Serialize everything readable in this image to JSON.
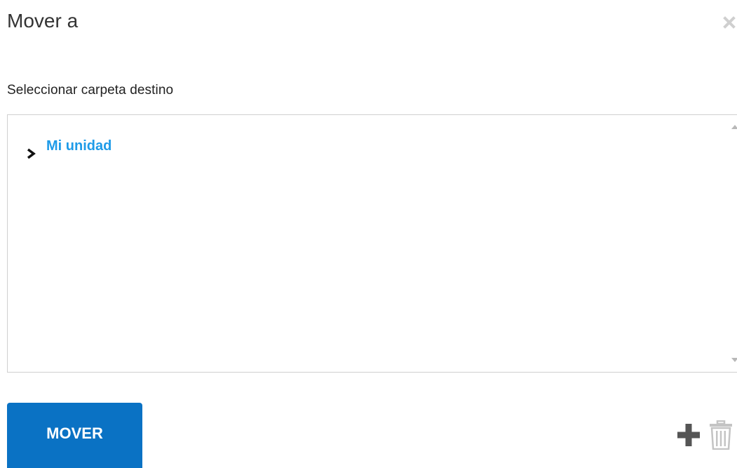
{
  "dialog": {
    "title": "Mover a",
    "close_icon": "close-icon"
  },
  "section": {
    "label": "Seleccionar carpeta destino"
  },
  "tree": {
    "nodes": [
      {
        "label": "Mi unidad",
        "expanded": false,
        "icon": "chevron-right-icon"
      }
    ],
    "scroll_icons": [
      "scroll-up-arrow-icon",
      "scroll-down-arrow-icon"
    ]
  },
  "actions": {
    "move_label": "MOVER",
    "add_icon": "plus-icon",
    "delete_icon": "trash-icon"
  },
  "colors": {
    "primary_button": "#0a72c4",
    "tree_link": "#1e9be8",
    "icon_gray": "#555555",
    "icon_light_gray": "#c4c4c4"
  }
}
